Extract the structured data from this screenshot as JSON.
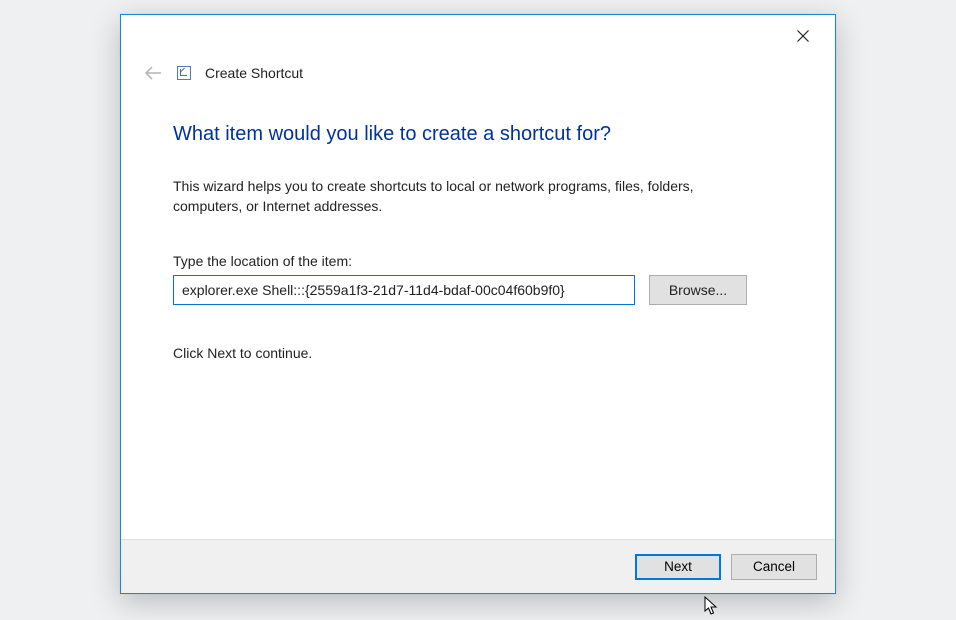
{
  "header": {
    "wizard_title": "Create Shortcut"
  },
  "main": {
    "question": "What item would you like to create a shortcut for?",
    "description": "This wizard helps you to create shortcuts to local or network programs, files, folders, computers, or Internet addresses.",
    "location_label": "Type the location of the item:",
    "location_value": "explorer.exe Shell:::{2559a1f3-21d7-11d4-bdaf-00c04f60b9f0}",
    "browse_label": "Browse...",
    "continue_text": "Click Next to continue."
  },
  "footer": {
    "next_label": "Next",
    "cancel_label": "Cancel"
  }
}
